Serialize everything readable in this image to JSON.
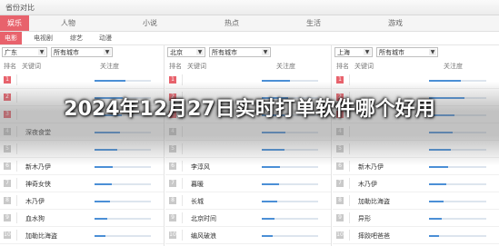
{
  "window": {
    "title": "省份对比"
  },
  "categories": [
    "娱乐",
    "人物",
    "小说",
    "热点",
    "生活",
    "游戏"
  ],
  "subtabs": [
    "电影",
    "电视剧",
    "综艺",
    "动漫"
  ],
  "columns": {
    "rank": "排名",
    "keyword": "关键词",
    "attention": "关注度"
  },
  "panels": [
    {
      "province": "广东",
      "city": "所有城市",
      "rows": [
        {
          "rank": "1",
          "keyword": "",
          "level": 0.55
        },
        {
          "rank": "2",
          "keyword": "",
          "level": 0.5
        },
        {
          "rank": "3",
          "keyword": "",
          "level": 0.48
        },
        {
          "rank": "4",
          "keyword": "深夜食堂",
          "level": 0.45
        },
        {
          "rank": "5",
          "keyword": "",
          "level": 0.4
        },
        {
          "rank": "6",
          "keyword": "新木乃伊",
          "level": 0.32
        },
        {
          "rank": "7",
          "keyword": "神奇女侠",
          "level": 0.3
        },
        {
          "rank": "8",
          "keyword": "木乃伊",
          "level": 0.27
        },
        {
          "rank": "9",
          "keyword": "血水狗",
          "level": 0.22
        },
        {
          "rank": "10",
          "keyword": "加勒比海盗",
          "level": 0.2
        }
      ]
    },
    {
      "province": "北京",
      "city": "所有城市",
      "rows": [
        {
          "rank": "1",
          "keyword": "",
          "level": 0.5
        },
        {
          "rank": "2",
          "keyword": "",
          "level": 0.47
        },
        {
          "rank": "3",
          "keyword": "",
          "level": 0.44
        },
        {
          "rank": "4",
          "keyword": "",
          "level": 0.42
        },
        {
          "rank": "5",
          "keyword": "",
          "level": 0.4
        },
        {
          "rank": "6",
          "keyword": "李淳风",
          "level": 0.33
        },
        {
          "rank": "7",
          "keyword": "暮暖",
          "level": 0.3
        },
        {
          "rank": "8",
          "keyword": "长城",
          "level": 0.27
        },
        {
          "rank": "9",
          "keyword": "北京时间",
          "level": 0.23
        },
        {
          "rank": "10",
          "keyword": "编风破浪",
          "level": 0.2
        }
      ]
    },
    {
      "province": "上海",
      "city": "所有城市",
      "rows": [
        {
          "rank": "1",
          "keyword": "",
          "level": 0.55
        },
        {
          "rank": "2",
          "keyword": "",
          "level": 0.62
        },
        {
          "rank": "3",
          "keyword": "",
          "level": 0.45
        },
        {
          "rank": "4",
          "keyword": "",
          "level": 0.42
        },
        {
          "rank": "5",
          "keyword": "",
          "level": 0.38
        },
        {
          "rank": "6",
          "keyword": "新木乃伊",
          "level": 0.33
        },
        {
          "rank": "7",
          "keyword": "木乃伊",
          "level": 0.3
        },
        {
          "rank": "8",
          "keyword": "加勒比海盗",
          "level": 0.26
        },
        {
          "rank": "9",
          "keyword": "异形",
          "level": 0.22
        },
        {
          "rank": "10",
          "keyword": "摔跤吧爸爸",
          "level": 0.18
        }
      ]
    }
  ],
  "headline": "2024年12月27日实时打单软件哪个好用",
  "colors": {
    "accent": "#e8626c",
    "bar": "#4b8fd6"
  }
}
